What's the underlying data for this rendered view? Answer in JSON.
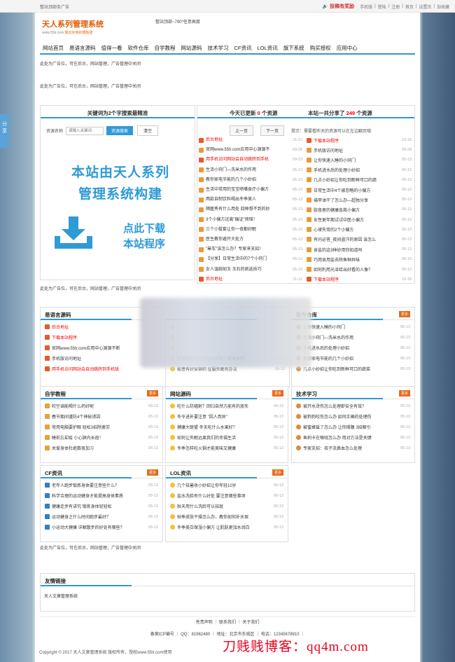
{
  "topbar": {
    "left": "整站顶部条广告",
    "submit": "投稿有奖励",
    "links": [
      "手机版",
      "登陆",
      "注册",
      "首页",
      "设置页",
      "加收藏"
    ]
  },
  "logo": {
    "title": "天人系列管理系统",
    "url": "www.55tr.com",
    "slogan": "做出好用的模板建"
  },
  "header_ad": "整站顶部~790*任意高度",
  "nav": [
    "网站首页",
    "易语言源码",
    "值得一看",
    "软件仓库",
    "自学教程",
    "网站源码",
    "技术学习",
    "CF资讯",
    "LOL资讯",
    "旗下系统",
    "购买授权",
    "应用中心"
  ],
  "ads": {
    "a1": "此处为广告位，可在后台，网站管理，广告管理中关闭",
    "a2": "此处为广告位，可在后台，网站管理，广告管理中关闭",
    "a3": "此处为广告位，可在后台，网站管理，广告管理中关闭",
    "a4": "此处为广告位，可在后台，网站管理，广告管理中关闭"
  },
  "side_flag": "分享",
  "search": {
    "title": "关键词为2个字搜索最精准",
    "label": "资源名称",
    "placeholder": "请输入关键词",
    "submit": "资源搜索",
    "clear": "清空",
    "banner_line1": "本站由天人系列",
    "banner_line2": "管理系统构建",
    "banner_dl1": "点此下载",
    "banner_dl2": "本站程序"
  },
  "stats": {
    "today_prefix": "今天已更新",
    "today_count": "0",
    "today_suffix": "个资源",
    "share_prefix": "本站一共分享了",
    "share_count": "249",
    "share_suffix": "个资源",
    "prev": "上一页",
    "next": "下一页",
    "tip": "提示：需要看昨天的资源可以在左边翻页哦"
  },
  "center_list": [
    {
      "t": "后台地址",
      "d": "11-12",
      "red": true
    },
    {
      "t": "官网www.55tr.com应用中心源源不",
      "d": "09-28",
      "red": false
    },
    {
      "t": "用手机访问网站会自动跳转到手机",
      "d": "09-23",
      "red": true
    },
    {
      "t": "生活小窍门—洗米水的作用",
      "d": "05-13",
      "red": false
    },
    {
      "t": "教你家电节能的几个小妙招",
      "d": "05-13",
      "red": false
    },
    {
      "t": "生活中常用的宝宝喷嘴食疗小偏方",
      "d": "05-13",
      "red": false
    },
    {
      "t": "两款自制饮料喝出冬季美人",
      "d": "05-13",
      "red": false
    },
    {
      "t": "隔匿秀有什么用处 四种想不到的妙",
      "d": "05-13",
      "red": false
    },
    {
      "t": "3个小偏方远离\"痛证\"烦恼！",
      "d": "05-13",
      "red": false
    },
    {
      "t": "三个小拔套让你一夜都好眠",
      "d": "05-13",
      "red": false
    },
    {
      "t": "医生教你避开大处方",
      "d": "05-13",
      "red": false
    },
    {
      "t": "\"晕车\"该怎么办？专家来支招！",
      "d": "05-13",
      "red": false
    },
    {
      "t": "【分享】日常生活中的7个小窍门",
      "d": "05-13",
      "red": false
    },
    {
      "t": "女人温婉如玉 玉石的挑选技巧",
      "d": "05-13",
      "red": false
    },
    {
      "t": "后台地址",
      "d": "11-12",
      "red": true
    }
  ],
  "right_list": [
    {
      "t": "下载本站程序",
      "d": "10-18",
      "red": true
    },
    {
      "t": "手机版访问地址",
      "d": "09-28",
      "red": false
    },
    {
      "t": "让你快速入睡的小窍门",
      "d": "05-13",
      "red": false
    },
    {
      "t": "手机进水后的处理小妙招",
      "d": "05-13",
      "red": false
    },
    {
      "t": "几点小妙招让你吃到新鲜可口的蔬",
      "d": "05-13",
      "red": false
    },
    {
      "t": "日常生活中4个被忽略的小偏方",
      "d": "05-13",
      "red": false
    },
    {
      "t": "描甲油干了怎么办—超独分享",
      "d": "05-13",
      "red": false
    },
    {
      "t": "胶夜者的健康急救小偏方",
      "d": "05-13",
      "red": false
    },
    {
      "t": "女性更年期试试中医小偏方",
      "d": "05-13",
      "red": false
    },
    {
      "t": "心律失常的2个小偏方",
      "d": "05-13",
      "red": false
    },
    {
      "t": "有问必答_夜间盗汗的原因 该怎么",
      "d": "05-13",
      "red": false
    },
    {
      "t": "食盐的这3种妙用你知道吗",
      "d": "05-13",
      "red": false
    },
    {
      "t": "巧用食用盐去除鱼种异味",
      "d": "05-13",
      "red": false
    },
    {
      "t": "如何利用光泽给出好看的人像？",
      "d": "05-13",
      "red": false
    },
    {
      "t": "下载本站程序",
      "d": "10-18",
      "red": true
    }
  ],
  "sections": {
    "yyy": {
      "title": "易语言源码",
      "more": "更多",
      "items": [
        {
          "t": "后台地址",
          "d": "11-12",
          "red": true,
          "ic": "rss"
        },
        {
          "t": "下载本站程序",
          "d": "10-18",
          "red": true,
          "ic": "rss"
        },
        {
          "t": "官网www.55tr.com应用中心源源不断",
          "d": "09-28",
          "red": false,
          "ic": "rss"
        },
        {
          "t": "手机版访问地址",
          "d": "09-28",
          "red": false,
          "ic": "rss"
        },
        {
          "t": "用手机访问网站会自动跳转到手机版",
          "d": "09-23",
          "red": true,
          "ic": "rss"
        }
      ]
    },
    "mid": {
      "title": "",
      "more": "",
      "items": [
        {
          "t": "",
          "d": "",
          "red": false,
          "ic": "star"
        },
        {
          "t": "",
          "d": "",
          "red": false,
          "ic": "star"
        },
        {
          "t": "",
          "d": "",
          "red": false,
          "ic": "star"
        },
        {
          "t": "在哪面吃什么不容易鼾呢？解毒食物",
          "d": "05-13",
          "red": false,
          "ic": "star"
        },
        {
          "t": "能患有好安顿药 征服失眠有办法",
          "d": "05-13",
          "red": false,
          "ic": "star"
        }
      ]
    },
    "rj": {
      "title": "软件仓库",
      "more": "更多",
      "items": [
        {
          "t": "让你快速入睡的小窍门",
          "d": "05-13",
          "red": false,
          "ic": "user"
        },
        {
          "t": "生活小窍门—洗米水的作用",
          "d": "05-13",
          "red": false,
          "ic": "user"
        },
        {
          "t": "手机进水后的处理小妙招",
          "d": "05-13",
          "red": false,
          "ic": "user"
        },
        {
          "t": "教你家电节能的几个小妙招",
          "d": "05-13",
          "red": false,
          "ic": "user"
        },
        {
          "t": "几点小妙招让你吃到新鲜可口的蔬菜",
          "d": "05-13",
          "red": false,
          "ic": "user"
        }
      ]
    },
    "zx": {
      "title": "自学教程",
      "more": "更多",
      "items": [
        {
          "t": "吹空调能喝什么药好呢",
          "d": "05-13",
          "red": false,
          "ic": "book"
        },
        {
          "t": "春节期间谨防4个神秘诱因",
          "d": "05-13",
          "red": false,
          "ic": "book"
        },
        {
          "t": "常用电脑要护眼 轻松3招除疲劳",
          "d": "05-13",
          "red": false,
          "ic": "book"
        },
        {
          "t": "睡前忘却疫 小心顾内长痘！",
          "d": "05-13",
          "red": false,
          "ic": "book"
        },
        {
          "t": "关爱身体杜绝数夜加习",
          "d": "05-13",
          "red": false,
          "ic": "book"
        }
      ]
    },
    "wz": {
      "title": "网站源码",
      "more": "更多",
      "items": [
        {
          "t": "吃什么防辐射？回归自然方能有的放矢",
          "d": "05-13",
          "red": false,
          "ic": "star"
        },
        {
          "t": "冬令进补要注意 \"因人而异\"",
          "d": "05-13",
          "red": false,
          "ic": "star"
        },
        {
          "t": "健康大联盟 冬天吃什么水果好？",
          "d": "05-13",
          "red": false,
          "ic": "star"
        },
        {
          "t": "如何让失眠远离我们的幸福生活",
          "d": "05-13",
          "red": false,
          "ic": "star"
        },
        {
          "t": "冬季怎样吃火锅才能美味又健康",
          "d": "05-13",
          "red": false,
          "ic": "star"
        }
      ]
    },
    "js": {
      "title": "技术学习",
      "more": "更多",
      "items": [
        {
          "t": "被开水烫伤怎么处理即安全有效？",
          "d": "05-13",
          "red": false,
          "ic": "user"
        },
        {
          "t": "被狗狗咬伤怎么办 如何正确的处理伤",
          "d": "05-13",
          "red": false,
          "ic": "user"
        },
        {
          "t": "被蜜蜂蜇了怎么办 让你撑腰 3招解引",
          "d": "05-13",
          "red": false,
          "ic": "user"
        },
        {
          "t": "鱼刺卡在喉咙怎么办 用对方法是关键",
          "d": "05-13",
          "red": false,
          "ic": "user"
        },
        {
          "t": "专家支招：孩子流鼻血怎么处理",
          "d": "05-13",
          "red": false,
          "ic": "user"
        }
      ]
    },
    "cf": {
      "title": "CF资讯",
      "more": "更多",
      "items": [
        {
          "t": "老年人跑步锻炼身体要注意些什么？",
          "d": "05-13",
          "red": false,
          "ic": "news"
        },
        {
          "t": "科学合理的运动健身才能提高身体素质",
          "d": "05-13",
          "red": false,
          "ic": "news"
        },
        {
          "t": "健康走步有讲究 锻炼身体轻轻松",
          "d": "05-13",
          "red": false,
          "ic": "news"
        },
        {
          "t": "运动健身之什么时间跑步最好？",
          "d": "05-13",
          "red": false,
          "ic": "news"
        },
        {
          "t": "小运动大健康 详解散步的好处有哪些？",
          "d": "05-13",
          "red": false,
          "ic": "news"
        }
      ]
    },
    "lol": {
      "title": "LOL资讯",
      "more": "更多",
      "items": [
        {
          "t": "几个祛暑收小妙招让你年轻10岁",
          "d": "05-13",
          "red": false,
          "ic": "star"
        },
        {
          "t": "盐水洗脸有什么好处 要注意哪些事项",
          "d": "05-13",
          "red": false,
          "ic": "star"
        },
        {
          "t": "秋天用什么洗脸可以祛斑",
          "d": "05-13",
          "red": false,
          "ic": "star"
        },
        {
          "t": "秋季皮肤干燥怎么办，教你如何补水保",
          "d": "05-13",
          "red": false,
          "ic": "star"
        },
        {
          "t": "冬季美白保湿小偏方 让肌肤更加水润白",
          "d": "05-13",
          "red": false,
          "ic": "star"
        }
      ]
    }
  },
  "links": {
    "title": "友情链接",
    "items": [
      "天人文章管理系统"
    ]
  },
  "footer": {
    "links": [
      "免责声明",
      "联系我们",
      "关于我们"
    ],
    "icp": "备案ICP编号",
    "qq": "QQ：81962480",
    "addr": "地址：北京市东城区",
    "tel": "电话：12345678910",
    "copyright": "Copyright © 2017 天人文章管理系统 版权所有，授权www.55tr.com使用"
  },
  "watermark": "刀贱贱博客：qq4m.com"
}
